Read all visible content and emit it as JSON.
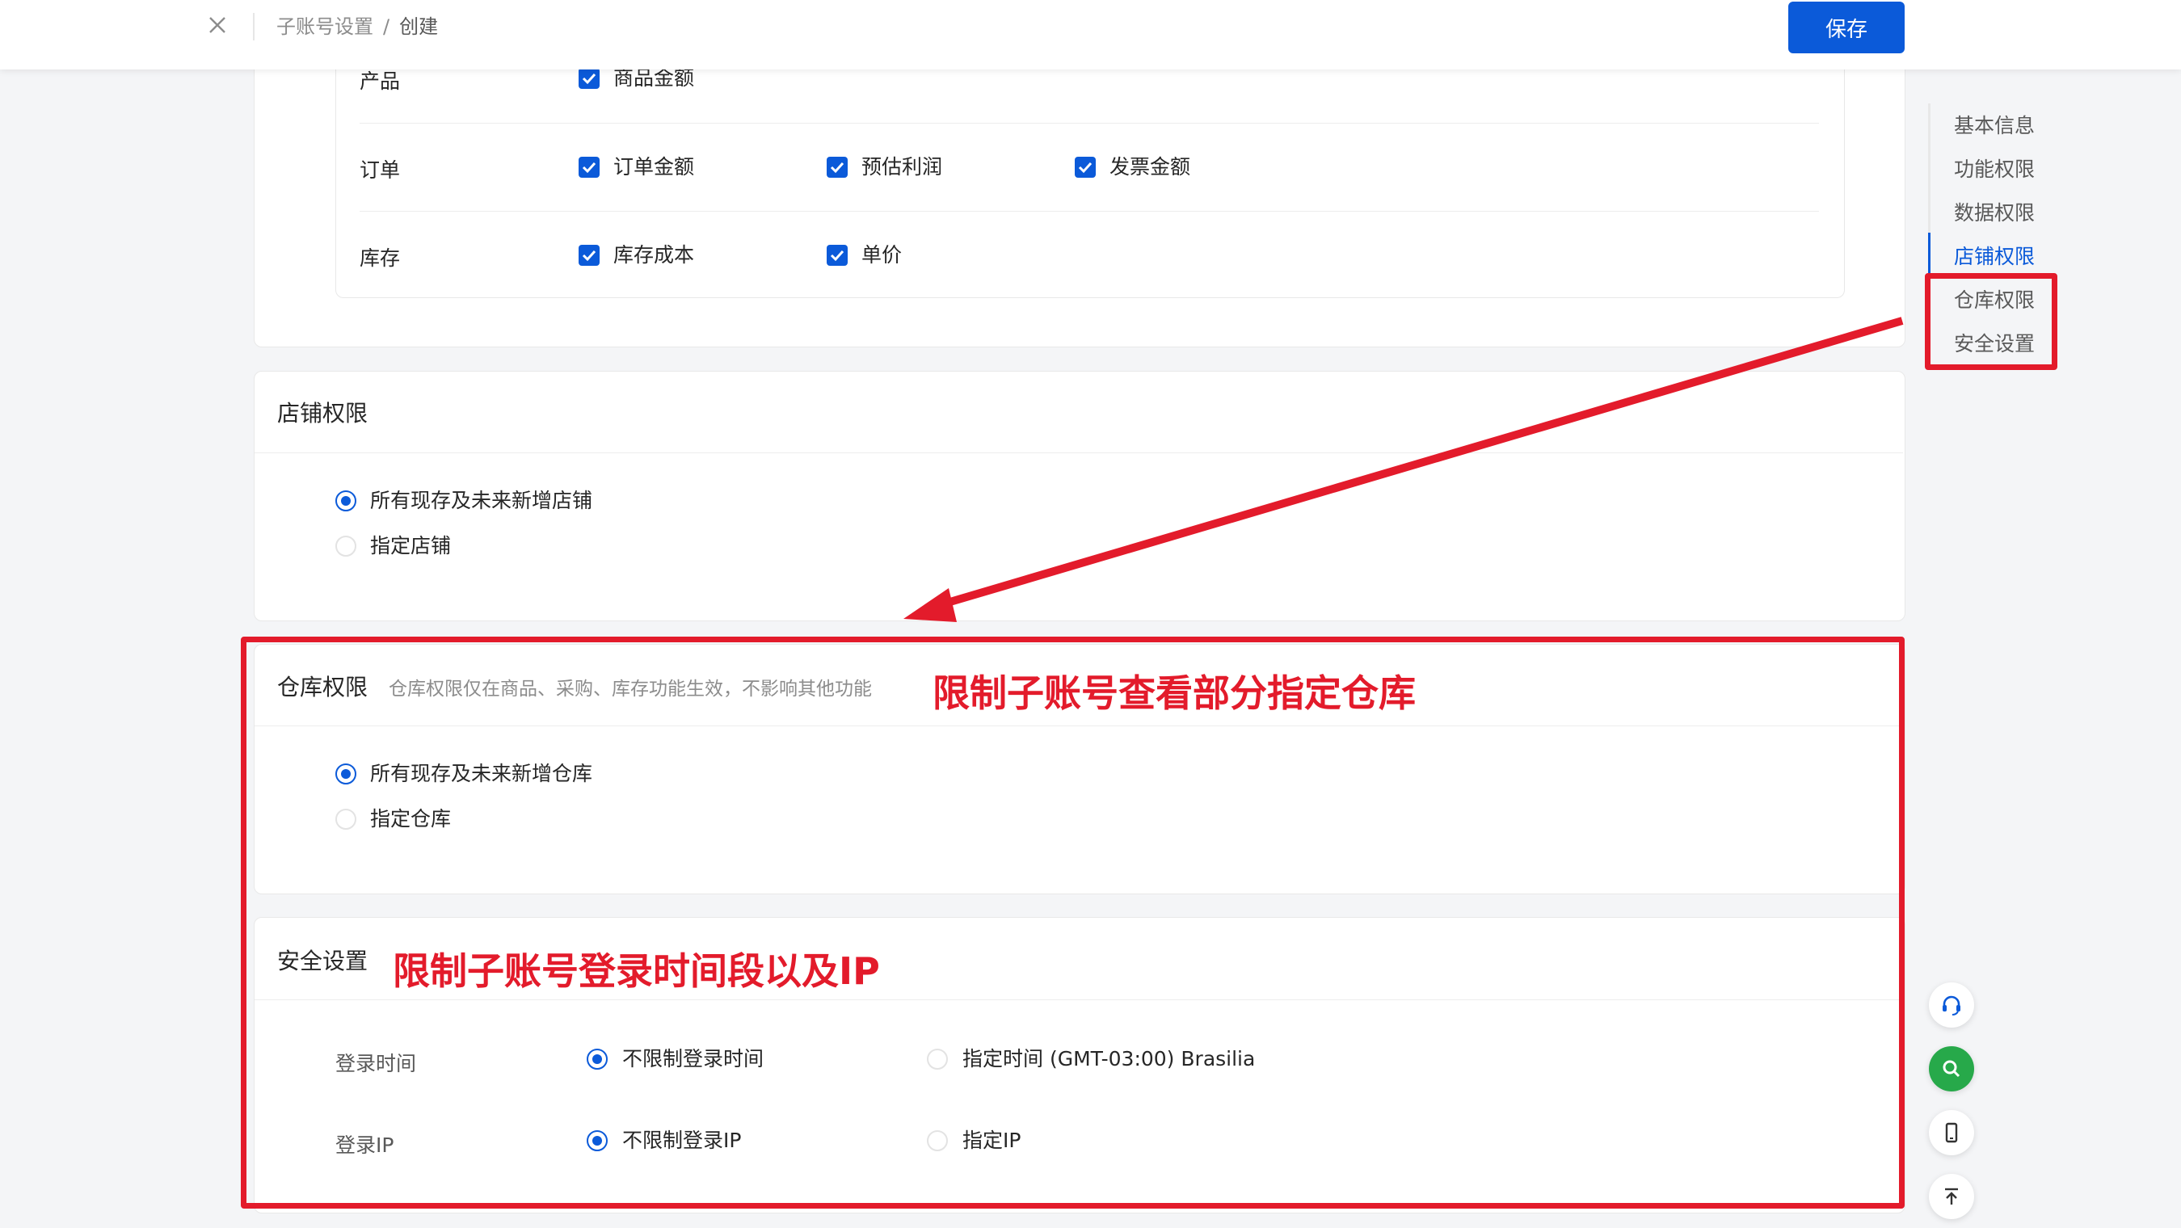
{
  "header": {
    "breadcrumb_parent": "子账号设置",
    "breadcrumb_sep": "/",
    "breadcrumb_current": "创建",
    "save_label": "保存"
  },
  "data_permissions": {
    "rows": [
      {
        "label": "产品",
        "options": [
          "商品金额"
        ]
      },
      {
        "label": "订单",
        "options": [
          "订单金额",
          "预估利润",
          "发票金额"
        ]
      },
      {
        "label": "库存",
        "options": [
          "库存成本",
          "单价"
        ]
      }
    ]
  },
  "shop_permissions": {
    "title": "店铺权限",
    "options": [
      "所有现存及未来新增店铺",
      "指定店铺"
    ],
    "selected": 0
  },
  "warehouse_permissions": {
    "title": "仓库权限",
    "subtitle": "仓库权限仅在商品、采购、库存功能生效，不影响其他功能",
    "options": [
      "所有现存及未来新增仓库",
      "指定仓库"
    ],
    "selected": 0
  },
  "security": {
    "title": "安全设置",
    "login_time_label": "登录时间",
    "login_time_options": [
      "不限制登录时间",
      "指定时间 (GMT-03:00) Brasilia"
    ],
    "login_ip_label": "登录IP",
    "login_ip_options": [
      "不限制登录IP",
      "指定IP"
    ]
  },
  "anchor_nav": {
    "items": [
      "基本信息",
      "功能权限",
      "数据权限",
      "店铺权限",
      "仓库权限",
      "安全设置"
    ],
    "active": "店铺权限"
  },
  "annotations": {
    "warehouse_note": "限制子账号查看部分指定仓库",
    "security_note": "限制子账号登录时间段以及IP",
    "color": "#e31b2b"
  },
  "colors": {
    "primary": "#0b5ad9",
    "success": "#27a94a"
  },
  "floating_icons": [
    "headset-icon",
    "search-icon",
    "mobile-icon",
    "back-to-top-icon"
  ]
}
